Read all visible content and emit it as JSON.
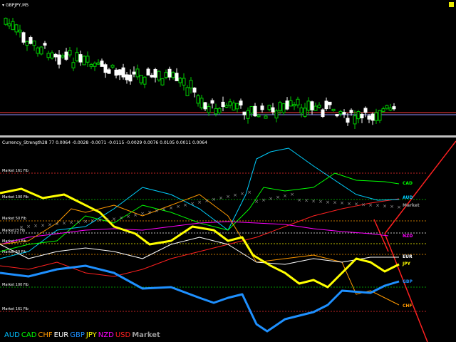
{
  "main": {
    "title": "GBPJPY,M5",
    "colors": {
      "bull": "#ffffff",
      "bear": "#00cc00",
      "hline1": "#ff3b3b",
      "hline2": "#9090ff"
    }
  },
  "indicator": {
    "title": "Currency_Strength28 77 0.0064 -0.0028 -0.0071 -0.0115 -0.0029 0.0076 0.0105 0.0011 0.0064",
    "levels": [
      "Market 161 Fib",
      "Market 100 Fib",
      "Market 50 Fib",
      "Market23 Fib",
      "Market 23 Fib",
      "Market 50 Fib",
      "Market 100 Fib",
      "Market 161 Fib"
    ],
    "labels": [
      {
        "text": "CAD",
        "color": "#00ff00"
      },
      {
        "text": "AUD",
        "color": "#00d0ff"
      },
      {
        "text": "Market",
        "color": "#9a9a9a"
      },
      {
        "text": "NZD",
        "color": "#ff00ff"
      },
      {
        "text": "EUR",
        "color": "#ffffff"
      },
      {
        "text": "JPY",
        "color": "#ffff00"
      },
      {
        "text": "GBP",
        "color": "#1e90ff"
      },
      {
        "text": "CHF",
        "color": "#ff9900"
      }
    ],
    "legend": [
      {
        "text": "AUD",
        "color": "#00bfff"
      },
      {
        "text": "CAD",
        "color": "#00ff00"
      },
      {
        "text": "CHF",
        "color": "#ff9900"
      },
      {
        "text": "EUR",
        "color": "#ffffff"
      },
      {
        "text": "GBP",
        "color": "#1e90ff"
      },
      {
        "text": "JPY",
        "color": "#ffff00"
      },
      {
        "text": "NZD",
        "color": "#ff00ff"
      },
      {
        "text": "USD",
        "color": "#ff2020"
      },
      {
        "text": "Market",
        "color": "#9a9a9a"
      }
    ]
  }
}
